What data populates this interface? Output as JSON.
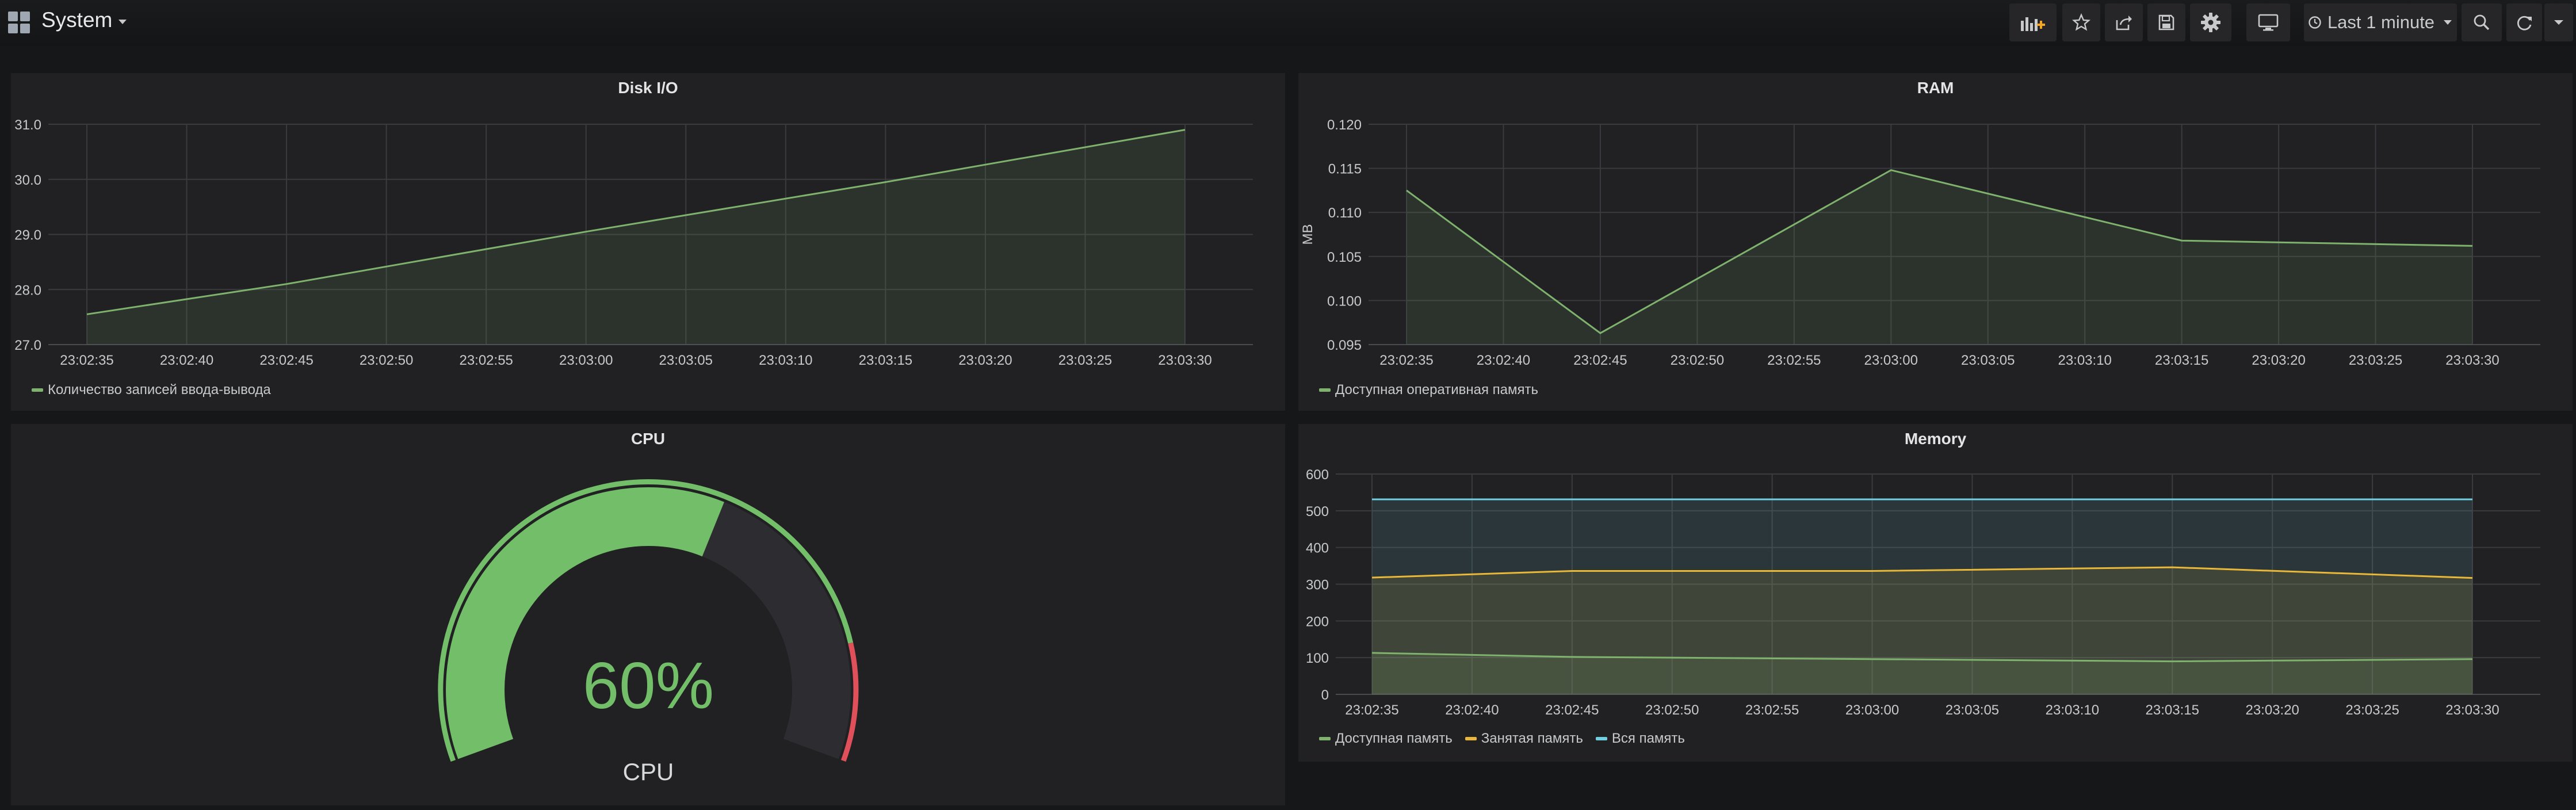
{
  "header": {
    "dashboard_title": "System",
    "time_range_label": "Last 1 minute",
    "icons": [
      "grid-icon",
      "add-panel-icon",
      "star-icon",
      "share-icon",
      "save-icon",
      "settings-icon",
      "tv-mode-icon",
      "clock-icon",
      "zoom-out-icon",
      "refresh-icon",
      "chevron-down-icon"
    ]
  },
  "panels": {
    "disk_io": {
      "title": "Disk I/O",
      "legend": [
        {
          "label": "Количество записей ввода-вывода",
          "color": "#7eb26d"
        }
      ]
    },
    "ram": {
      "title": "RAM",
      "legend": [
        {
          "label": "Доступная оперативная память",
          "color": "#7eb26d"
        }
      ]
    },
    "cpu": {
      "title": "CPU",
      "value": 60,
      "value_text": "60%",
      "label": "CPU",
      "thresholds": [
        {
          "upto": 85,
          "color": "#73bf69"
        },
        {
          "upto": 100,
          "color": "#e0505a"
        }
      ]
    },
    "memory": {
      "title": "Memory",
      "legend": [
        {
          "label": "Доступная память",
          "color": "#7eb26d"
        },
        {
          "label": "Занятая память",
          "color": "#eab839"
        },
        {
          "label": "Вся память",
          "color": "#6ed0e0"
        }
      ]
    }
  },
  "chart_data": [
    {
      "type": "area",
      "title": "Disk I/O",
      "x": [
        "23:02:35",
        "23:02:40",
        "23:02:45",
        "23:02:50",
        "23:02:55",
        "23:03:00",
        "23:03:05",
        "23:03:10",
        "23:03:15",
        "23:03:20",
        "23:03:25",
        "23:03:30"
      ],
      "x_points": [
        "23:02:35",
        "23:02:45",
        "23:03:00",
        "23:03:15",
        "23:03:30"
      ],
      "series": [
        {
          "name": "Количество записей ввода-вывода",
          "color": "#7eb26d",
          "values": [
            27.55,
            28.1,
            29.05,
            29.95,
            30.9
          ]
        }
      ],
      "yticks": [
        "27.0",
        "28.0",
        "29.0",
        "30.0",
        "31.0"
      ],
      "ylim": [
        27.0,
        31.0
      ],
      "ylabel": "",
      "grid": true,
      "legend_position": "bottom-left"
    },
    {
      "type": "area",
      "title": "RAM",
      "x": [
        "23:02:35",
        "23:02:40",
        "23:02:45",
        "23:02:50",
        "23:02:55",
        "23:03:00",
        "23:03:05",
        "23:03:10",
        "23:03:15",
        "23:03:20",
        "23:03:25",
        "23:03:30"
      ],
      "x_points": [
        "23:02:35",
        "23:02:45",
        "23:03:00",
        "23:03:15",
        "23:03:30"
      ],
      "series": [
        {
          "name": "Доступная оперативная память",
          "color": "#7eb26d",
          "values": [
            0.1125,
            0.0963,
            0.1148,
            0.1068,
            0.1062
          ]
        }
      ],
      "yticks": [
        "0.095",
        "0.100",
        "0.105",
        "0.110",
        "0.115",
        "0.120"
      ],
      "ylim": [
        0.095,
        0.12
      ],
      "ylabel": "MB",
      "grid": true,
      "legend_position": "bottom-left"
    },
    {
      "type": "area",
      "title": "Memory",
      "x": [
        "23:02:35",
        "23:02:40",
        "23:02:45",
        "23:02:50",
        "23:02:55",
        "23:03:00",
        "23:03:05",
        "23:03:10",
        "23:03:15",
        "23:03:20",
        "23:03:25",
        "23:03:30"
      ],
      "x_points": [
        "23:02:35",
        "23:02:45",
        "23:03:00",
        "23:03:15",
        "23:03:30"
      ],
      "series": [
        {
          "name": "Доступная память",
          "color": "#7eb26d",
          "values": [
            113,
            102,
            96,
            90,
            96
          ]
        },
        {
          "name": "Занятая память",
          "color": "#eab839",
          "values": [
            318,
            336,
            336,
            346,
            317
          ]
        },
        {
          "name": "Вся память",
          "color": "#6ed0e0",
          "values": [
            531,
            531,
            531,
            531,
            531
          ]
        }
      ],
      "yticks": [
        "0",
        "100",
        "200",
        "300",
        "400",
        "500",
        "600"
      ],
      "ylim": [
        0,
        600
      ],
      "ylabel": "",
      "grid": true,
      "legend_position": "bottom-left"
    }
  ]
}
